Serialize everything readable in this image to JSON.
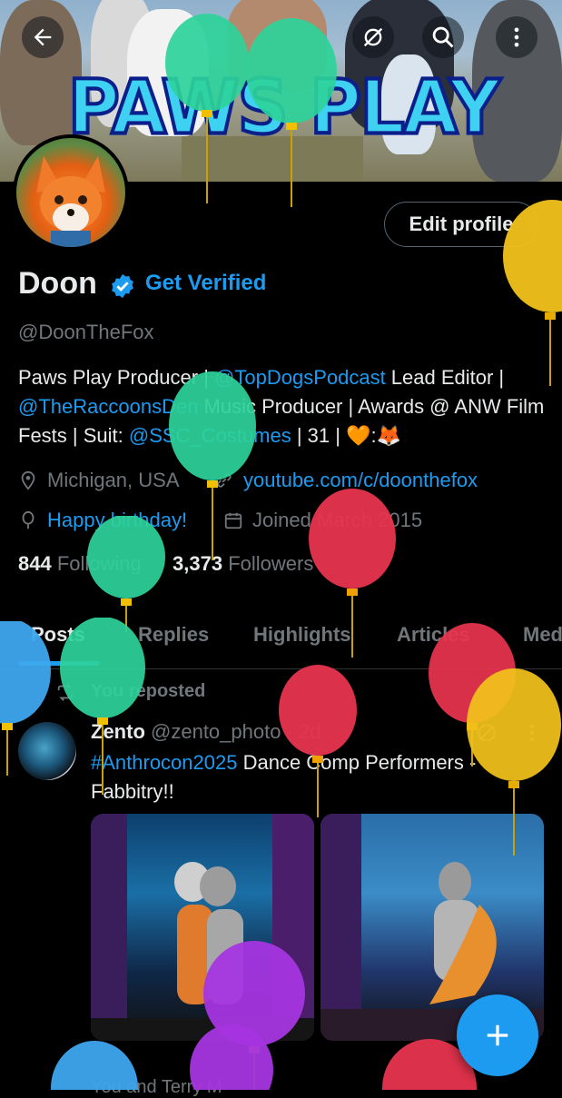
{
  "banner": {
    "title": "PAWS PLAY"
  },
  "header": {
    "back_icon": "arrow-left-icon",
    "sync_icon": "sync-off-icon",
    "search_icon": "search-icon",
    "more_icon": "more-vertical-icon"
  },
  "profile": {
    "edit_label": "Edit profile",
    "display_name": "Doon",
    "get_verified": "Get Verified",
    "handle": "@DoonTheFox",
    "bio": {
      "t1": "Paws Play Producer | ",
      "l1": "@TopDogsPodcast",
      "t2": " Lead Editor | ",
      "l2": "@TheRaccoonsDen",
      "t3": " Music Producer | Awards @ ANW Film Fests | ",
      "t4": "Suit: ",
      "l3": "@SSC_Costumes",
      "t5": " | 31 | ",
      "emoji": "🧡:🦊"
    },
    "location": "Michigan, USA",
    "website": "youtube.com/c/doonthefox",
    "birthday": "Happy birthday!",
    "joined": "Joined March 2015",
    "following_count": "844",
    "following_label": "Following",
    "followers_count": "3,373",
    "followers_label": "Followers"
  },
  "tabs": [
    "Posts",
    "Replies",
    "Highlights",
    "Articles",
    "Media"
  ],
  "active_tab": "Posts",
  "post": {
    "repost_label": "You reposted",
    "author": "Zento",
    "author_handle": "@zento_photo",
    "time": "· 2d",
    "hashtag": "#Anthrocon2025",
    "text": " Dance Comp Performers - Fabbitry!!"
  },
  "bottom_partial_text": "You and Terry M",
  "fab_icon": "plus-icon",
  "colors": {
    "accent": "#1d9bf0",
    "background": "#000000",
    "muted": "#71767b",
    "text": "#e7e9ea"
  }
}
